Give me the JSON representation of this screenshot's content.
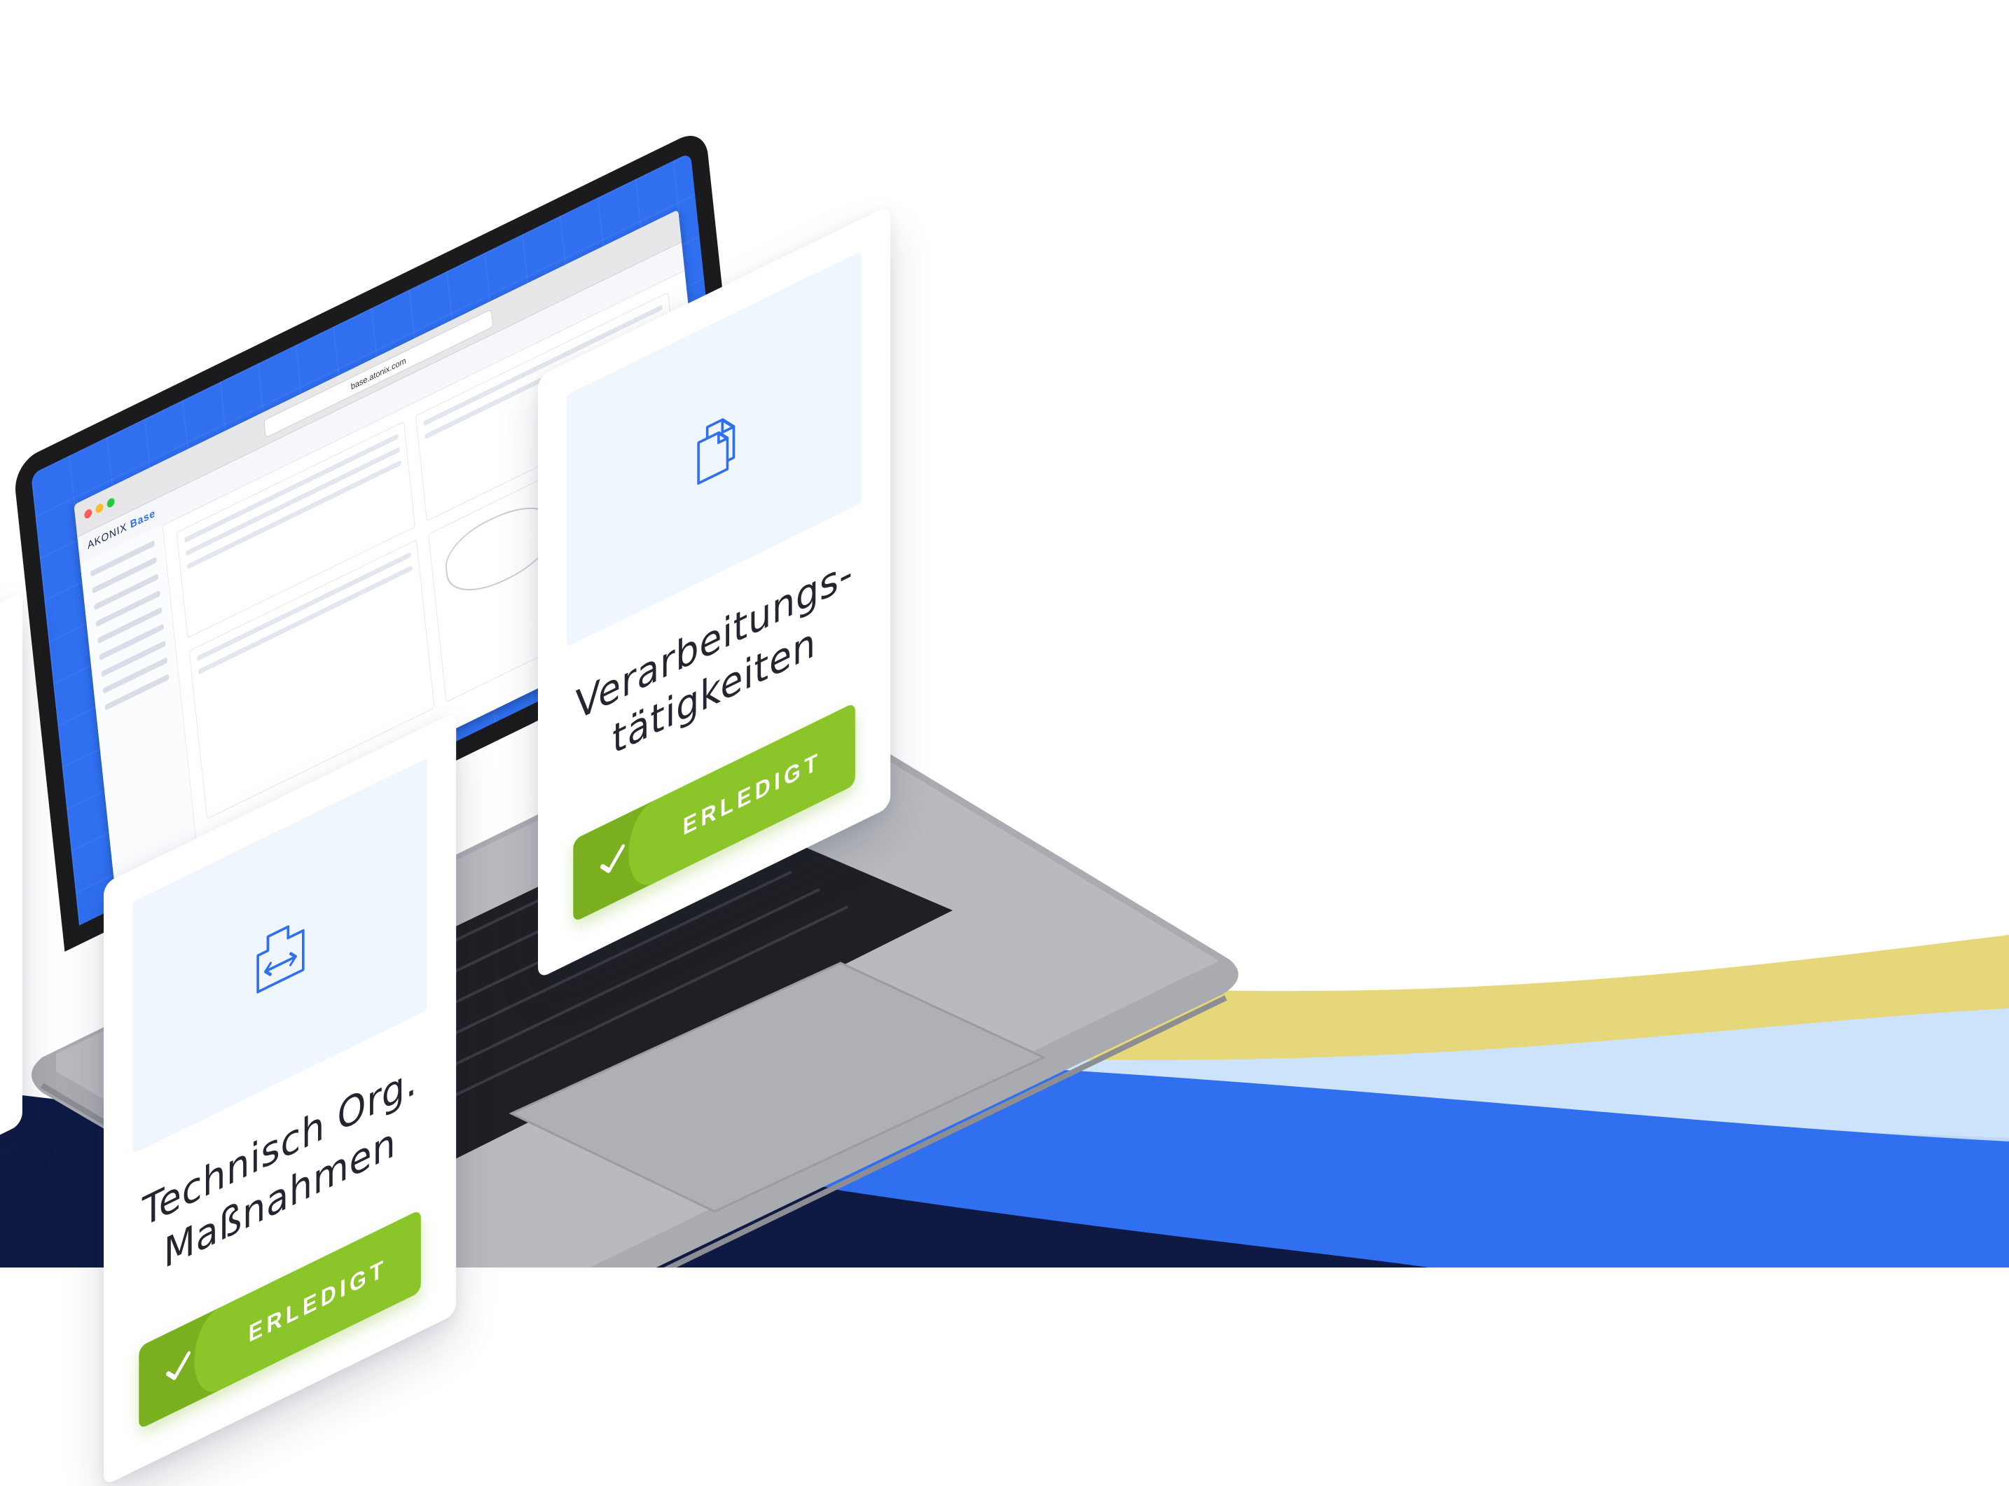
{
  "screen": {
    "url": "base.atonix.com",
    "app_logo_prefix": "AKONIX",
    "app_logo_suffix": "Base"
  },
  "cards": [
    {
      "title_line1": "Technisch Org.",
      "title_line2": "Maßnahmen",
      "icon": "document-transfer-icon",
      "button_label": "ERLEDIGT"
    },
    {
      "title_line1": "Verarbeitungs-",
      "title_line2": "tätigkeiten",
      "icon": "documents-stack-icon",
      "button_label": "ERLEDIGT"
    }
  ],
  "colors": {
    "brand_blue": "#2f6ff0",
    "navy": "#0f1a44",
    "light_blue": "#cde3fc",
    "yellow": "#e6d77a",
    "success_green": "#8cc52a",
    "card_tile": "#f0f6fe"
  }
}
